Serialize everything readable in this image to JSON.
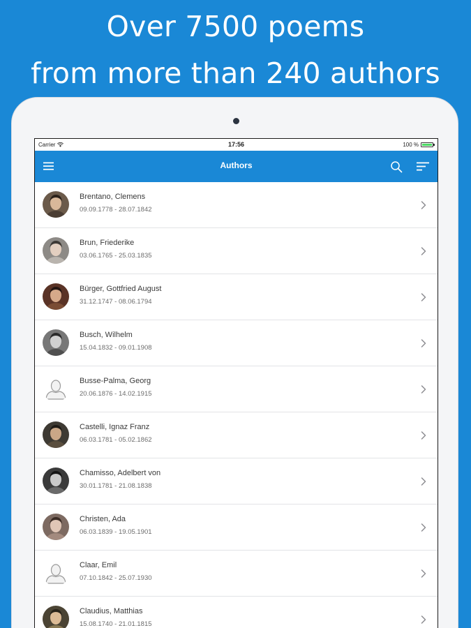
{
  "headline": {
    "line1": "Over 7500 poems",
    "line2": "from more than 240 authors"
  },
  "status_bar": {
    "carrier": "Carrier",
    "time": "17:56",
    "battery": "100 %"
  },
  "nav_bar": {
    "title": "Authors"
  },
  "authors": [
    {
      "name": "Brentano, Clemens",
      "dates": "09.09.1778 - 28.07.1842",
      "avatar": "portrait"
    },
    {
      "name": "Brun, Friederike",
      "dates": "03.06.1765 - 25.03.1835",
      "avatar": "portrait"
    },
    {
      "name": "Bürger, Gottfried August",
      "dates": "31.12.1747 - 08.06.1794",
      "avatar": "portrait"
    },
    {
      "name": "Busch, Wilhelm",
      "dates": "15.04.1832 - 09.01.1908",
      "avatar": "portrait"
    },
    {
      "name": "Busse-Palma, Georg",
      "dates": "20.06.1876 - 14.02.1915",
      "avatar": "placeholder-person-icon"
    },
    {
      "name": "Castelli, Ignaz Franz",
      "dates": "06.03.1781 - 05.02.1862",
      "avatar": "portrait"
    },
    {
      "name": "Chamisso, Adelbert von",
      "dates": "30.01.1781 - 21.08.1838",
      "avatar": "portrait"
    },
    {
      "name": "Christen, Ada",
      "dates": "06.03.1839 - 19.05.1901",
      "avatar": "portrait"
    },
    {
      "name": "Claar, Emil",
      "dates": "07.10.1842 - 25.07.1930",
      "avatar": "placeholder-person-icon"
    },
    {
      "name": "Claudius, Matthias",
      "dates": "15.08.1740 - 21.01.1815",
      "avatar": "portrait"
    }
  ],
  "colors": {
    "brand_blue": "#1a88d6",
    "battery_green": "#4cd964"
  }
}
